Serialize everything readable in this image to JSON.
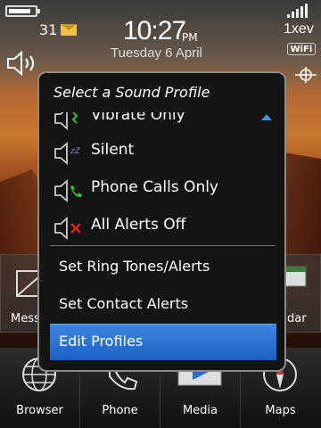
{
  "status_bar": {
    "battery_level": 0.85,
    "message_count": "31",
    "time": "10:27",
    "ampm": "PM",
    "date": "Tuesday 6 April",
    "carrier": "1xev",
    "wifi_label": "WiFi"
  },
  "popup": {
    "title": "Select a Sound Profile",
    "profiles": [
      {
        "label": "Vibrate Only",
        "icon": "speaker-vibrate-icon"
      },
      {
        "label": "Silent",
        "icon": "speaker-silent-icon"
      },
      {
        "label": "Phone Calls Only",
        "icon": "speaker-phone-icon"
      },
      {
        "label": "All Alerts Off",
        "icon": "speaker-off-icon"
      }
    ],
    "actions": [
      {
        "label": "Set Ring Tones/Alerts",
        "selected": false
      },
      {
        "label": "Set Contact Alerts",
        "selected": false
      },
      {
        "label": "Edit Profiles",
        "selected": true
      }
    ]
  },
  "home_row": {
    "left_label": "Mess",
    "right_label": "dar"
  },
  "dock": {
    "items": [
      {
        "label": "Browser",
        "icon": "globe-icon"
      },
      {
        "label": "Phone",
        "icon": "phone-icon"
      },
      {
        "label": "Media",
        "icon": "media-icon"
      },
      {
        "label": "Maps",
        "icon": "compass-icon"
      }
    ]
  },
  "colors": {
    "accent": "#2a6fd0",
    "popup_bg": "#141414",
    "popup_border": "#8c8c8c"
  }
}
